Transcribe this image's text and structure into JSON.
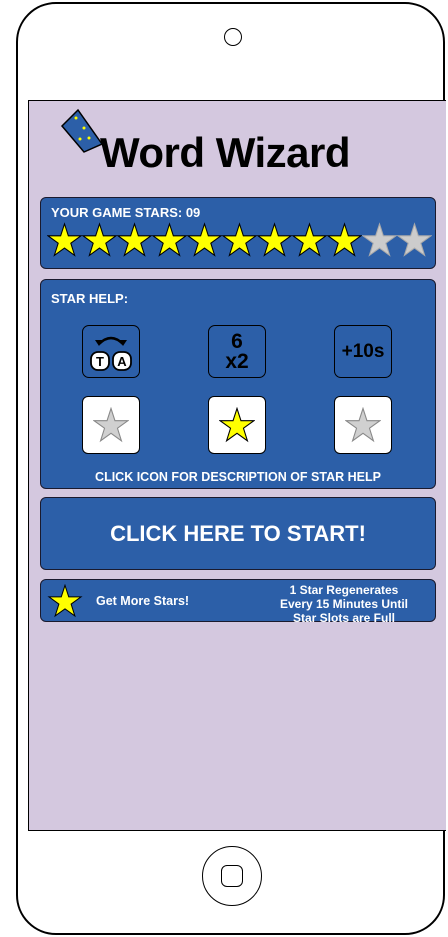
{
  "app": {
    "title": "Word Wizard"
  },
  "stars_panel": {
    "label": "YOUR GAME STARS: 09",
    "filled": 9,
    "total": 11
  },
  "help_panel": {
    "label": "STAR HELP:",
    "icons": [
      {
        "name": "swap-letters",
        "letters": [
          "T",
          "A"
        ]
      },
      {
        "name": "double-score",
        "line1": "6",
        "line2": "x2"
      },
      {
        "name": "add-time",
        "text": "+10s"
      }
    ],
    "slots": [
      "empty",
      "filled",
      "empty"
    ],
    "note": "CLICK ICON FOR DESCRIPTION OF STAR HELP"
  },
  "start": {
    "label": "CLICK HERE TO START!"
  },
  "more": {
    "label": "Get More Stars!",
    "regen": [
      "1 Star Regenerates",
      "Every 15 Minutes Until",
      "Star Slots are Full"
    ]
  },
  "colors": {
    "panel": "#2c5fa8",
    "screen": "#d4c8df",
    "star_filled": "#ffff00",
    "star_empty": "#cccccc"
  }
}
